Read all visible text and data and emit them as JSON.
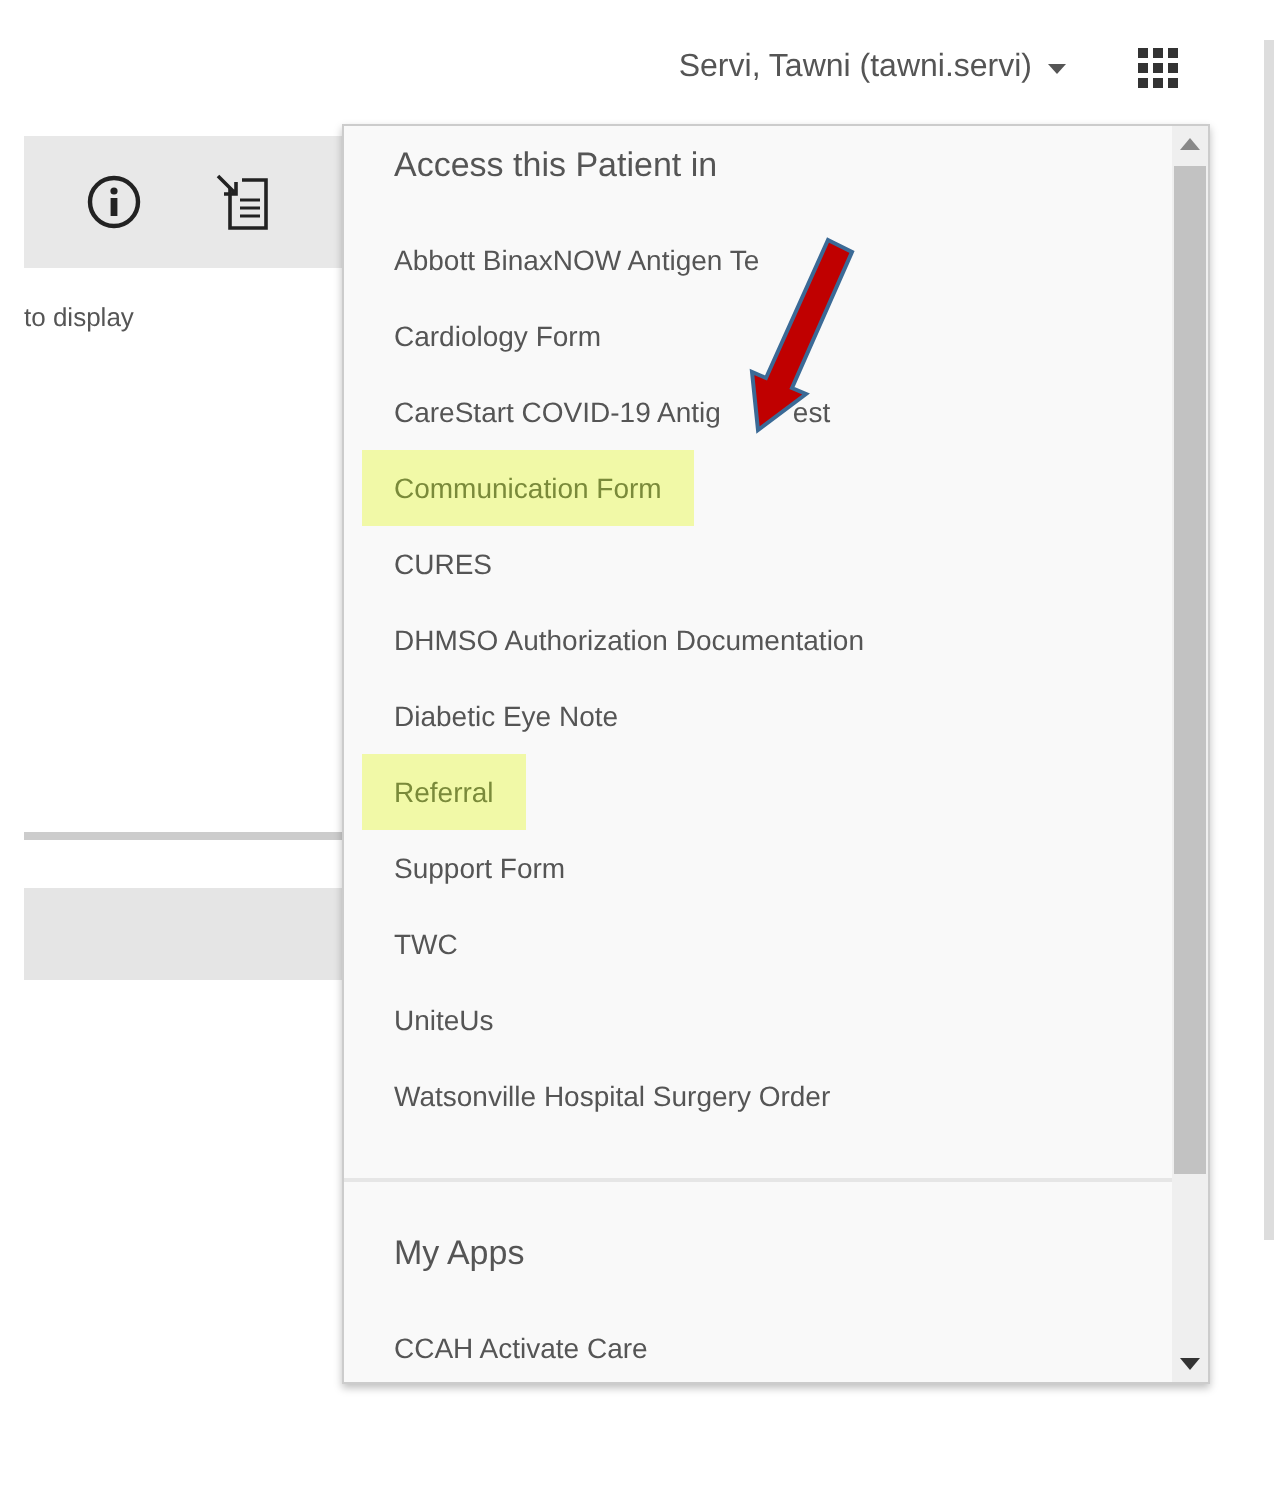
{
  "header": {
    "user_menu": "Servi, Tawni (tawni.servi)"
  },
  "background": {
    "message": "to display"
  },
  "dropdown": {
    "sections": [
      {
        "title": "Access this Patient in",
        "items": [
          {
            "label": "Abbott BinaxNOW Antigen Te",
            "highlighted": false
          },
          {
            "label": "Cardiology Form",
            "highlighted": false
          },
          {
            "label": "CareStart COVID-19 Antig",
            "label_tail": "est",
            "highlighted": false
          },
          {
            "label": "Communication Form",
            "highlighted": true
          },
          {
            "label": "CURES",
            "highlighted": false
          },
          {
            "label": "DHMSO Authorization Documentation",
            "highlighted": false
          },
          {
            "label": "Diabetic Eye Note",
            "highlighted": false
          },
          {
            "label": "Referral",
            "highlighted": true
          },
          {
            "label": "Support Form",
            "highlighted": false
          },
          {
            "label": "TWC",
            "highlighted": false
          },
          {
            "label": "UniteUs",
            "highlighted": false
          },
          {
            "label": "Watsonville Hospital Surgery Order",
            "highlighted": false
          }
        ]
      },
      {
        "title": "My Apps",
        "items": [
          {
            "label": "CCAH Activate Care",
            "highlighted": false
          }
        ]
      }
    ]
  }
}
